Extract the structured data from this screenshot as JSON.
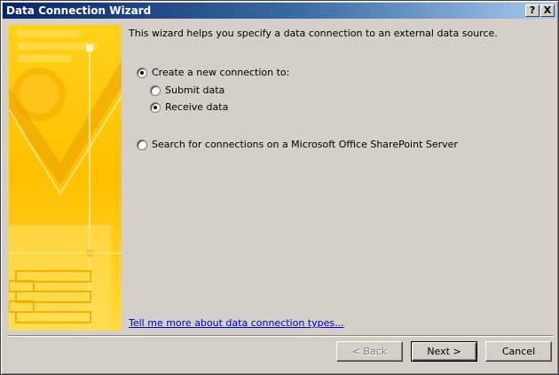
{
  "window": {
    "title": "Data Connection Wizard"
  },
  "titlebar": {
    "help_label": "?",
    "close_label": "X"
  },
  "intro": "This wizard helps you specify a data connection to an external data source.",
  "options": {
    "create_new": {
      "label": "Create a new connection to:",
      "selected": true
    },
    "submit_data": {
      "label": "Submit data",
      "selected": false
    },
    "receive_data": {
      "label": "Receive data",
      "selected": true
    },
    "search_sharepoint": {
      "label": "Search for connections on a Microsoft Office SharePoint Server",
      "selected": false
    }
  },
  "help_link": "Tell me more about data connection types...",
  "buttons": {
    "back": "< Back",
    "next": "Next >",
    "cancel": "Cancel"
  },
  "colors": {
    "titlebar_start": "#0a246a",
    "titlebar_end": "#a6caf0",
    "face": "#d4d0c8",
    "link": "#0000cc",
    "banner_yellow": "#ffc000"
  }
}
